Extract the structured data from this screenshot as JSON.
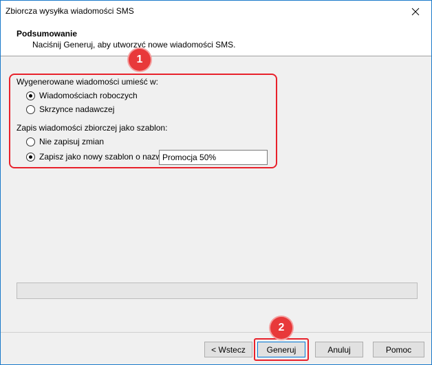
{
  "window": {
    "title": "Zbiorcza wysyłka wiadomości SMS",
    "close_icon": "close-icon"
  },
  "header": {
    "title": "Podsumowanie",
    "subtitle": "Naciśnij Generuj, aby utworzyć nowe wiadomości SMS."
  },
  "destination": {
    "label": "Wygenerowane wiadomości umieść w:",
    "options": [
      {
        "label": "Wiadomościach roboczych",
        "selected": true
      },
      {
        "label": "Skrzynce nadawczej",
        "selected": false
      }
    ]
  },
  "template": {
    "label": "Zapis wiadomości zbiorczej jako szablon:",
    "options": [
      {
        "label": "Nie zapisuj zmian",
        "selected": false
      },
      {
        "label": "Zapisz jako nowy szablon o nazwie:",
        "selected": true
      }
    ],
    "name_value": "Promocja 50%"
  },
  "annotations": {
    "badge1": "1",
    "badge2": "2",
    "highlight_color": "#e8202a"
  },
  "footer": {
    "back": "< Wstecz",
    "generate": "Generuj",
    "cancel": "Anuluj",
    "help": "Pomoc"
  }
}
